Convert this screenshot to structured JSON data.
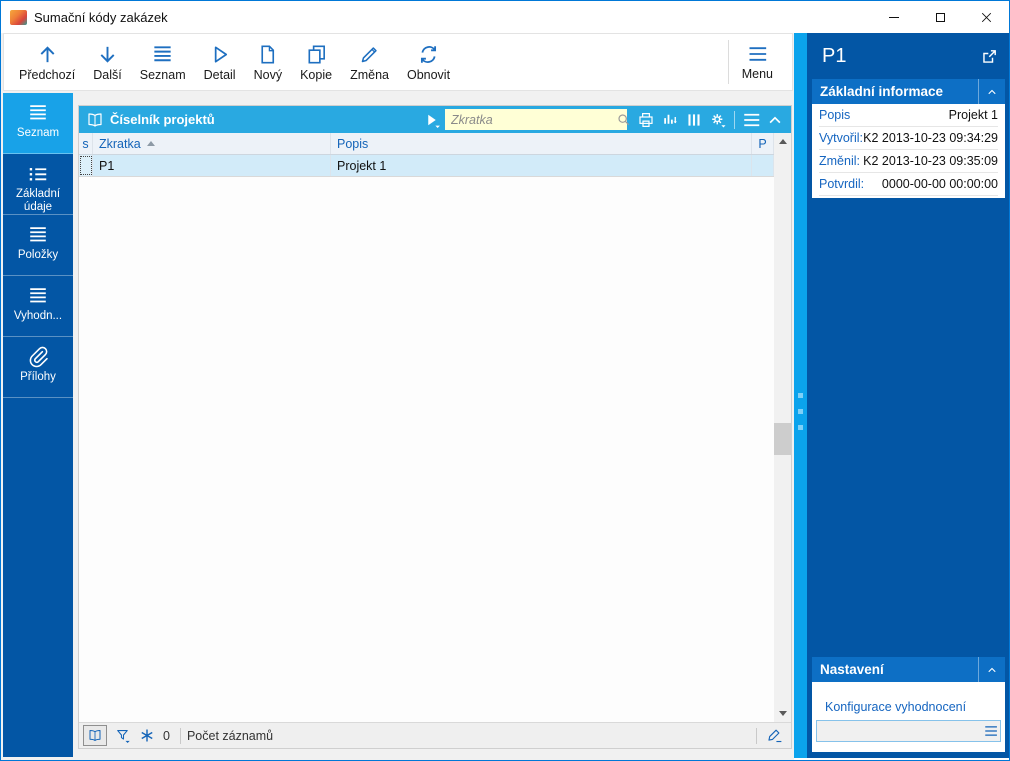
{
  "window": {
    "title": "Sumační kódy zakázek"
  },
  "toolbar": {
    "buttons": [
      {
        "label": "Předchozí",
        "icon": "arrow-up"
      },
      {
        "label": "Další",
        "icon": "arrow-down"
      },
      {
        "label": "Seznam",
        "icon": "list"
      },
      {
        "label": "Detail",
        "icon": "play-outline"
      },
      {
        "label": "Nový",
        "icon": "new-document"
      },
      {
        "label": "Kopie",
        "icon": "copy"
      },
      {
        "label": "Změna",
        "icon": "pencil"
      },
      {
        "label": "Obnovit",
        "icon": "refresh"
      }
    ],
    "menu_label": "Menu"
  },
  "sidebar": {
    "items": [
      {
        "label": "Seznam",
        "icon": "list",
        "active": true
      },
      {
        "label": "Základní údaje",
        "icon": "detail-list",
        "active": false
      },
      {
        "label": "Položky",
        "icon": "list",
        "active": false
      },
      {
        "label": "Vyhodn...",
        "icon": "list",
        "active": false
      },
      {
        "label": "Přílohy",
        "icon": "paperclip",
        "active": false
      }
    ]
  },
  "table": {
    "title": "Číselník projektů",
    "search": {
      "placeholder": "Zkratka",
      "value": ""
    },
    "columns": {
      "selector": "s",
      "zkratka": "Zkratka",
      "popis": "Popis",
      "p": "P"
    },
    "sort": {
      "column": "Zkratka",
      "direction": "asc"
    },
    "rows": [
      {
        "zkratka": "P1",
        "popis": "Projekt 1"
      }
    ],
    "status": {
      "frozen_count": "0",
      "records_label": "Počet záznamů"
    }
  },
  "right_panel": {
    "record_title": "P1",
    "basic_info": {
      "title": "Základní informace",
      "fields": [
        {
          "label": "Popis",
          "value": "Projekt 1"
        },
        {
          "label": "Vytvořil:",
          "value": "K2 2013-10-23 09:34:29"
        },
        {
          "label": "Změnil:",
          "value": "K2 2013-10-23 09:35:09"
        },
        {
          "label": "Potvrdil:",
          "value": "0000-00-00 00:00:00"
        }
      ]
    },
    "settings": {
      "title": "Nastavení",
      "config_label": "Konfigurace vyhodnocení",
      "config_value": ""
    }
  },
  "colors": {
    "accent": "#0078D7",
    "panel_blue": "#0356A5",
    "highlight_blue": "#18A2E8",
    "table_title_blue": "#29A9E1",
    "section_header_blue": "#0D6FC5",
    "search_bg": "#FFFFD6"
  }
}
